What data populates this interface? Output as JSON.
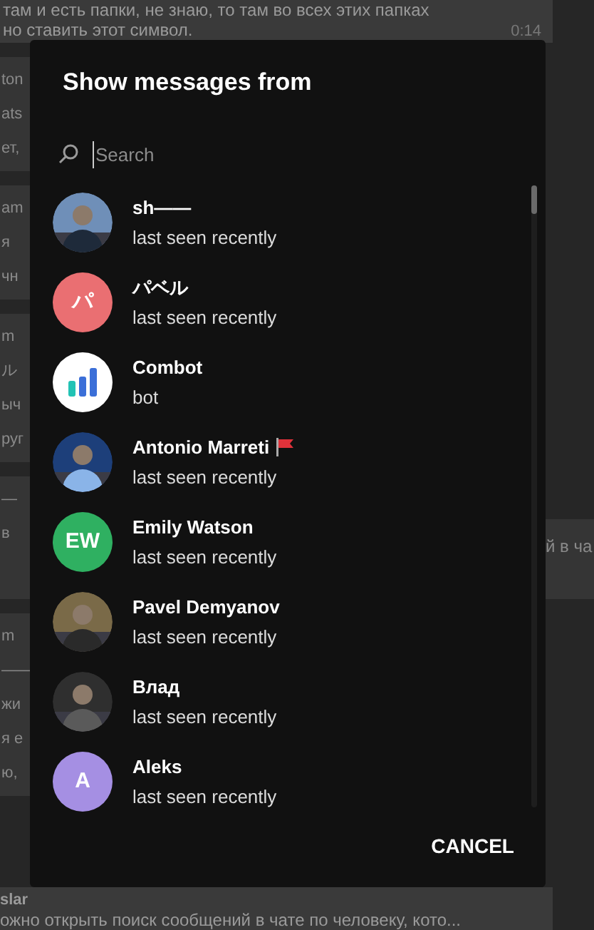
{
  "chat_background": {
    "top_message": {
      "lines": [
        "там и есть папки, не знаю, то там во всех этих папках",
        "но ставить этот символ."
      ],
      "time": "0:14"
    },
    "left_fragments": [
      [
        "ton",
        "ats",
        "ет,"
      ],
      [
        "am",
        "я",
        "чн"
      ],
      [
        "m",
        "ル",
        "ыч",
        "руг"
      ],
      [
        "—",
        "в"
      ],
      [
        "m",
        "——",
        "жи",
        "я е",
        "ю,"
      ]
    ],
    "right_fragment": "й в ча",
    "bottom_message": {
      "sender": "slar",
      "text": "ожно открыть поиск сообщений в чате по человеку, кото..."
    }
  },
  "dialog": {
    "title": "Show messages from",
    "search": {
      "placeholder": "Search"
    },
    "members": [
      {
        "name": "sh——",
        "status": "last seen recently",
        "flag": false
      },
      {
        "name": "パベル",
        "status": "last seen recently",
        "kind": "initials",
        "initials": "パ",
        "color": "#ea6f72",
        "flag": false
      },
      {
        "name": "Combot",
        "status": "bot",
        "kind": "bot-logo",
        "flag": false
      },
      {
        "name": "Antonio Marreti",
        "status": "last seen recently",
        "flag": true
      },
      {
        "name": "Emily Watson",
        "status": "last seen recently",
        "kind": "initials",
        "initials": "EW",
        "color": "#2fb061",
        "flag": false
      },
      {
        "name": "Pavel Demyanov",
        "status": "last seen recently",
        "flag": false
      },
      {
        "name": "Влад",
        "status": "last seen recently",
        "flag": false
      },
      {
        "name": "Aleks",
        "status": "last seen recently",
        "kind": "initials",
        "initials": "A",
        "color": "#a58fe3",
        "flag": false
      }
    ],
    "cancel_button": "CANCEL"
  }
}
